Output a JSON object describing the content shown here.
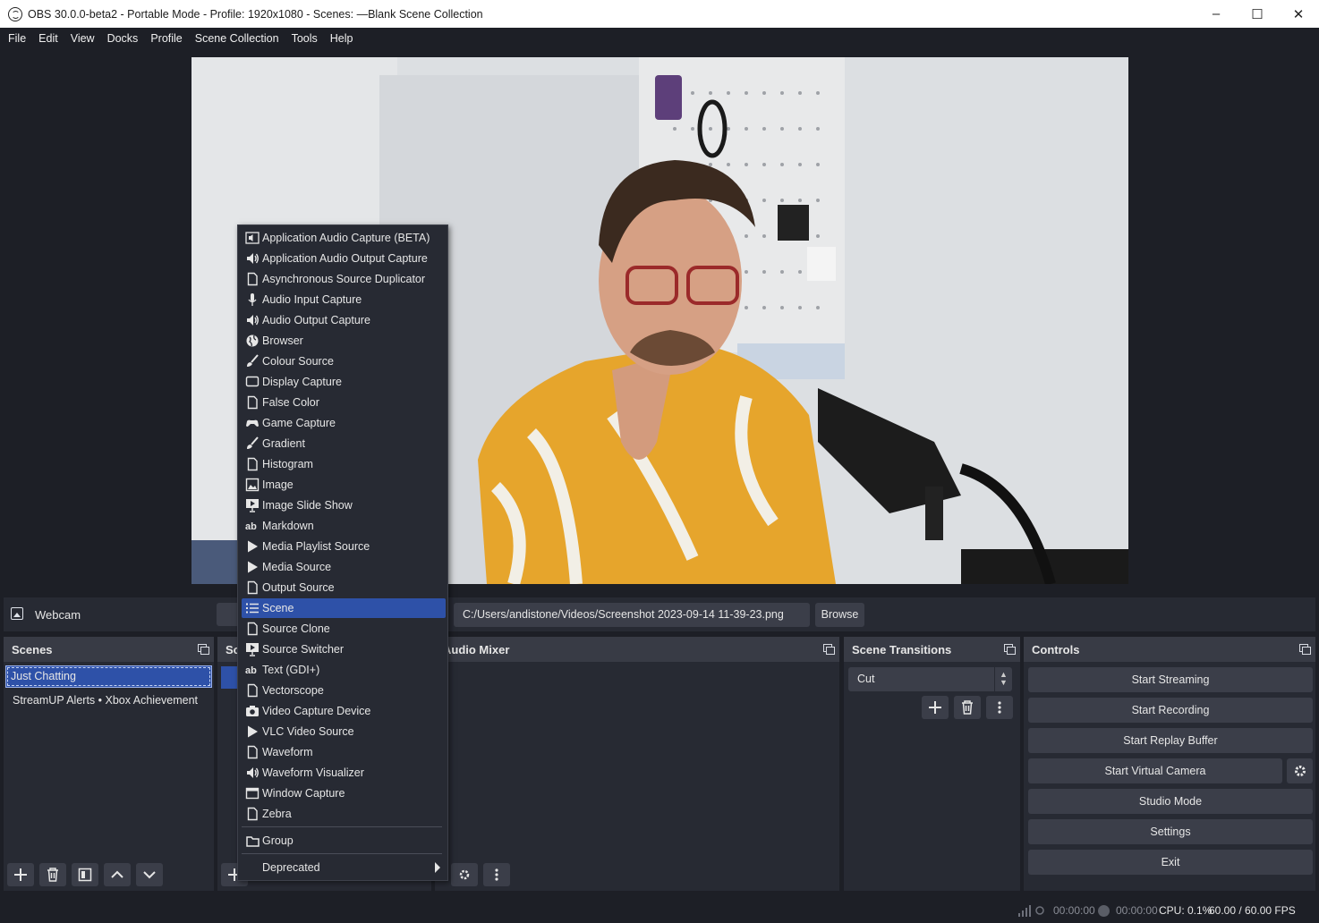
{
  "window": {
    "title": "OBS 30.0.0-beta2 - Portable Mode - Profile: 1920x1080 - Scenes: —Blank Scene Collection",
    "minimize": "–",
    "maximize": "☐",
    "close": "✕"
  },
  "menubar": [
    "File",
    "Edit",
    "View",
    "Docks",
    "Profile",
    "Scene Collection",
    "Tools",
    "Help"
  ],
  "source_toolbar": {
    "source_name": "Webcam",
    "path": "C:/Users/andistone/Videos/Screenshot 2023-09-14 11-39-23.png",
    "browse": "Browse"
  },
  "scenes": {
    "title": "Scenes",
    "items": [
      "Just Chatting",
      "StreamUP Alerts • Xbox Achievement"
    ]
  },
  "sources_dock": {
    "title": "So"
  },
  "audio_mixer": {
    "title": "Audio Mixer"
  },
  "transitions": {
    "title": "Scene Transitions",
    "selected": "Cut"
  },
  "controls": {
    "title": "Controls",
    "buttons": [
      "Start Streaming",
      "Start Recording",
      "Start Replay Buffer",
      "Start Virtual Camera",
      "Studio Mode",
      "Settings",
      "Exit"
    ]
  },
  "status": {
    "stream_time": "00:00:00",
    "record_time": "00:00:00",
    "cpu": "CPU: 0.1%",
    "fps": "60.00 / 60.00 FPS"
  },
  "add_source_menu": {
    "items": [
      {
        "label": "Application Audio Capture (BETA)",
        "icon": "app-audio-icon"
      },
      {
        "label": "Application Audio Output Capture",
        "icon": "speaker-icon"
      },
      {
        "label": "Asynchronous Source Duplicator",
        "icon": "file-icon"
      },
      {
        "label": "Audio Input Capture",
        "icon": "microphone-icon"
      },
      {
        "label": "Audio Output Capture",
        "icon": "speaker-icon"
      },
      {
        "label": "Browser",
        "icon": "globe-icon"
      },
      {
        "label": "Colour Source",
        "icon": "brush-icon"
      },
      {
        "label": "Display Capture",
        "icon": "monitor-icon"
      },
      {
        "label": "False Color",
        "icon": "file-icon"
      },
      {
        "label": "Game Capture",
        "icon": "gamepad-icon"
      },
      {
        "label": "Gradient",
        "icon": "brush-icon"
      },
      {
        "label": "Histogram",
        "icon": "file-icon"
      },
      {
        "label": "Image",
        "icon": "image-icon"
      },
      {
        "label": "Image Slide Show",
        "icon": "slideshow-icon"
      },
      {
        "label": "Markdown",
        "icon": "text-icon"
      },
      {
        "label": "Media Playlist Source",
        "icon": "play-icon"
      },
      {
        "label": "Media Source",
        "icon": "play-icon"
      },
      {
        "label": "Output Source",
        "icon": "file-icon"
      },
      {
        "label": "Scene",
        "icon": "list-icon"
      },
      {
        "label": "Source Clone",
        "icon": "file-icon"
      },
      {
        "label": "Source Switcher",
        "icon": "slideshow-icon"
      },
      {
        "label": "Text (GDI+)",
        "icon": "text-icon"
      },
      {
        "label": "Vectorscope",
        "icon": "file-icon"
      },
      {
        "label": "Video Capture Device",
        "icon": "camera-icon"
      },
      {
        "label": "VLC Video Source",
        "icon": "play-icon"
      },
      {
        "label": "Waveform",
        "icon": "file-icon"
      },
      {
        "label": "Waveform Visualizer",
        "icon": "speaker-icon"
      },
      {
        "label": "Window Capture",
        "icon": "window-icon"
      },
      {
        "label": "Zebra",
        "icon": "file-icon"
      }
    ],
    "group": "Group",
    "deprecated": "Deprecated",
    "highlighted": "Scene"
  }
}
